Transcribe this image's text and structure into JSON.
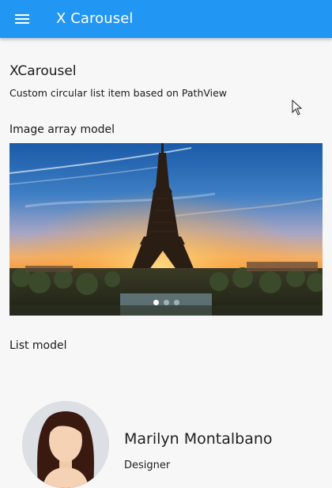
{
  "app_bar": {
    "title": "X Carousel",
    "menu_icon": "menu-icon",
    "background": "#2196f3"
  },
  "page": {
    "heading": "XCarousel",
    "subheading": "Custom circular list item based on PathView"
  },
  "image_section": {
    "label": "Image array model",
    "image": "eiffel-tower-sunset",
    "page_count": 3,
    "active_index": 0
  },
  "list_section": {
    "label": "List model",
    "items": [
      {
        "name": "Marilyn Montalbano",
        "role": "Designer",
        "avatar": "female-avatar"
      }
    ]
  }
}
